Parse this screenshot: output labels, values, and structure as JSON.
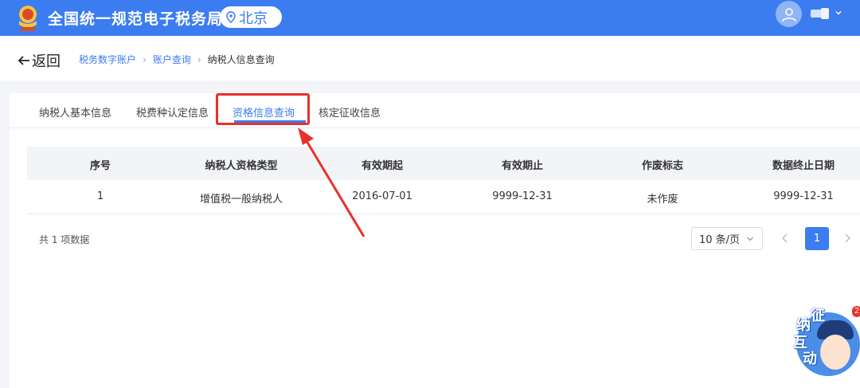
{
  "header": {
    "title": "全国统一规范电子税务局",
    "region": "北京",
    "colors": {
      "brand": "#3b7cf0"
    }
  },
  "breadcrumb": {
    "back_label": "返回",
    "items": [
      "税务数字账户",
      "账户查询",
      "纳税人信息查询"
    ]
  },
  "tabs": [
    {
      "label": "纳税人基本信息",
      "active": false
    },
    {
      "label": "税费种认定信息",
      "active": false
    },
    {
      "label": "资格信息查询",
      "active": true
    },
    {
      "label": "核定征收信息",
      "active": false
    }
  ],
  "table": {
    "columns": [
      "序号",
      "纳税人资格类型",
      "有效期起",
      "有效期止",
      "作废标志",
      "数据终止日期"
    ],
    "rows": [
      [
        "1",
        "增值税一般纳税人",
        "2016-07-01",
        "9999-12-31",
        "未作废",
        "9999-12-31"
      ]
    ]
  },
  "pagination": {
    "total_text": "共 1 项数据",
    "page_size": "10 条/页",
    "current_page": "1"
  },
  "mascot": {
    "chars": [
      "征",
      "纳",
      "互",
      "动"
    ],
    "badge": "2"
  }
}
